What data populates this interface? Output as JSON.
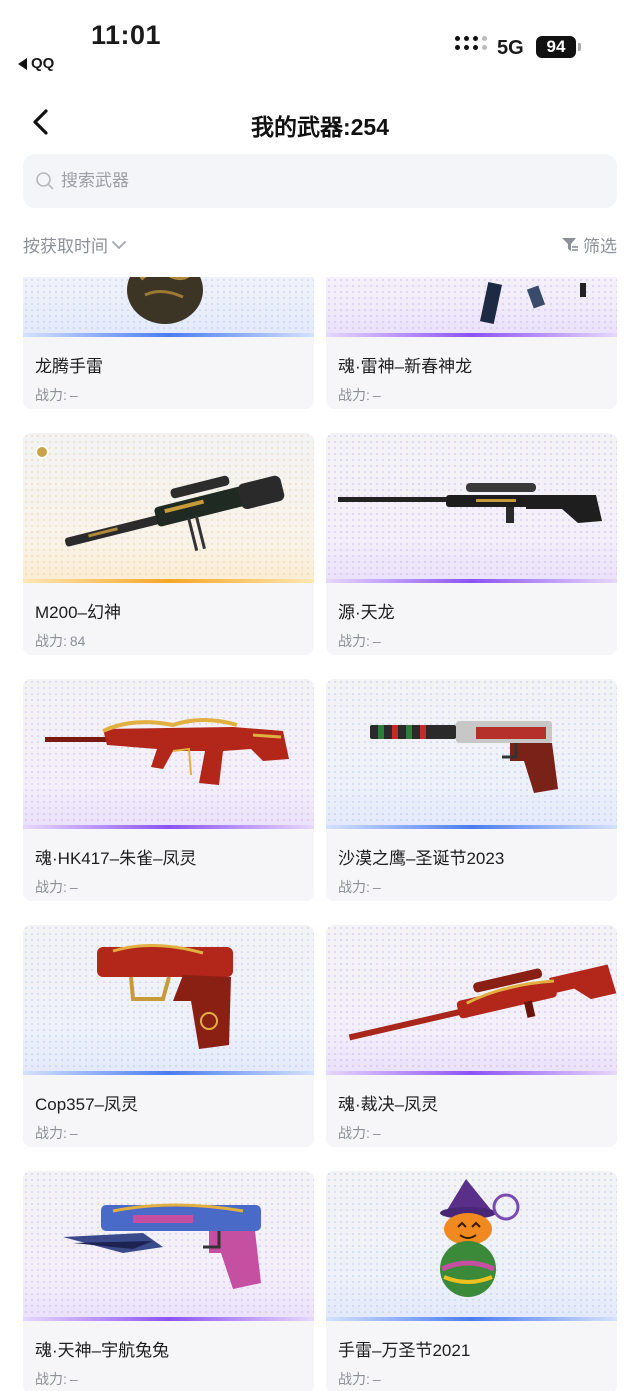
{
  "status_bar": {
    "time": "11:01",
    "back_app": "QQ",
    "network": "5G",
    "battery": "94"
  },
  "header": {
    "title": "我的武器:254"
  },
  "search": {
    "placeholder": "搜索武器"
  },
  "toolbar": {
    "sort_label": "按获取时间",
    "filter_label": "筛选"
  },
  "weapons": [
    {
      "name": "龙腾手雷",
      "power_label": "战力:",
      "power": "–",
      "rarity": "blue",
      "icon": "dragon-grenade"
    },
    {
      "name": "魂·雷神–新春神龙",
      "power_label": "战力:",
      "power": "–",
      "rarity": "purple",
      "icon": "rifle"
    },
    {
      "name": "M200–幻神",
      "power_label": "战力:",
      "power": "84",
      "rarity": "gold",
      "icon": "sniper-rifle"
    },
    {
      "name": "源·天龙",
      "power_label": "战力:",
      "power": "–",
      "rarity": "purple",
      "icon": "sniper-rifle"
    },
    {
      "name": "魂·HK417–朱雀–凤灵",
      "power_label": "战力:",
      "power": "–",
      "rarity": "purple",
      "icon": "assault-rifle"
    },
    {
      "name": "沙漠之鹰–圣诞节2023",
      "power_label": "战力:",
      "power": "–",
      "rarity": "blue",
      "icon": "pistol"
    },
    {
      "name": "Cop357–凤灵",
      "power_label": "战力:",
      "power": "–",
      "rarity": "blue",
      "icon": "pistol"
    },
    {
      "name": "魂·裁决–凤灵",
      "power_label": "战力:",
      "power": "–",
      "rarity": "purple",
      "icon": "sniper-rifle"
    },
    {
      "name": "魂·天神–宇航兔兔",
      "power_label": "战力:",
      "power": "–",
      "rarity": "purple",
      "icon": "pistol"
    },
    {
      "name": "手雷–万圣节2021",
      "power_label": "战力:",
      "power": "–",
      "rarity": "blue",
      "icon": "pumpkin-grenade"
    }
  ]
}
